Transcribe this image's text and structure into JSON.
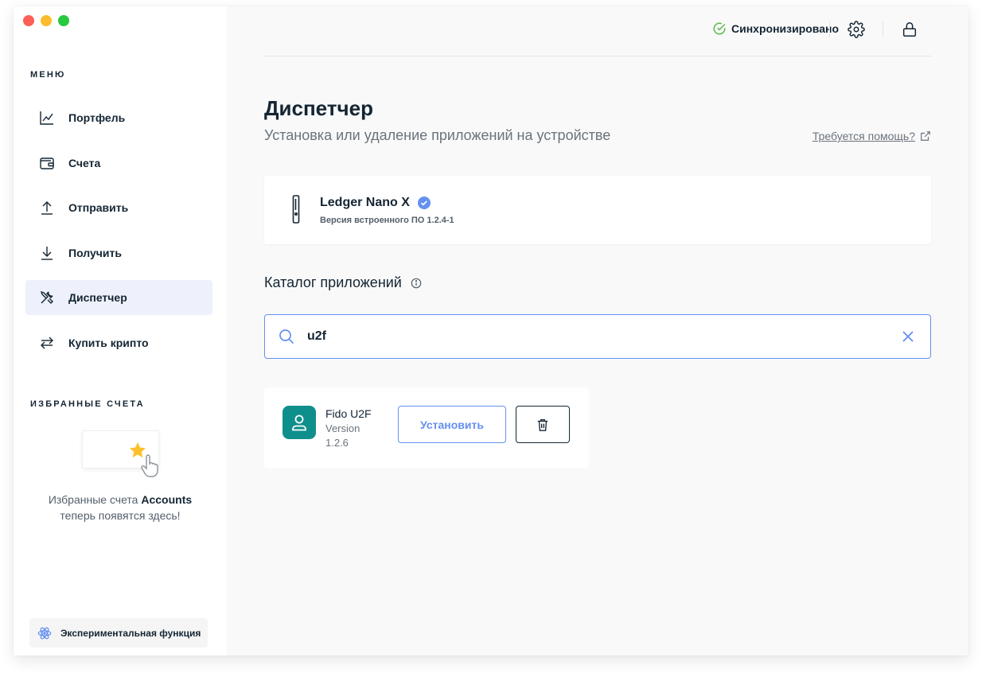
{
  "sidebar": {
    "menu_title": "МЕНЮ",
    "items": [
      {
        "label": "Портфель",
        "icon": "portfolio-chart-icon"
      },
      {
        "label": "Счета",
        "icon": "wallet-icon"
      },
      {
        "label": "Отправить",
        "icon": "send-arrow-up-icon"
      },
      {
        "label": "Получить",
        "icon": "receive-arrow-down-icon"
      },
      {
        "label": "Диспетчер",
        "icon": "manager-tools-icon",
        "active": true
      },
      {
        "label": "Купить крипто",
        "icon": "exchange-arrows-icon"
      }
    ],
    "favorites_title": "ИЗБРАННЫЕ СЧЕТА",
    "favorites_text_1": "Избранные счета",
    "favorites_text_bold": "Accounts",
    "favorites_text_2": "теперь появятся здесь!",
    "experimental_label": "Экспериментальная функция"
  },
  "topbar": {
    "sync_status": "Синхронизировано",
    "settings_icon": "gear-icon",
    "lock_icon": "lock-icon"
  },
  "main": {
    "title": "Диспетчер",
    "subtitle": "Установка или удаление приложений на устройстве",
    "help_link": "Требуется помощь?",
    "device": {
      "name": "Ledger Nano X",
      "firmware": "Версия встроенного ПО 1.2.4-1"
    },
    "catalog_title": "Каталог приложений",
    "search": {
      "value": "u2f"
    },
    "app": {
      "name": "Fido U2F",
      "version": "Version 1.2.6",
      "install_label": "Установить"
    }
  },
  "colors": {
    "accent": "#6490f1",
    "sync_green": "#66be54",
    "app_teal": "#0f8f8b",
    "active_bg": "#eef1fb"
  }
}
